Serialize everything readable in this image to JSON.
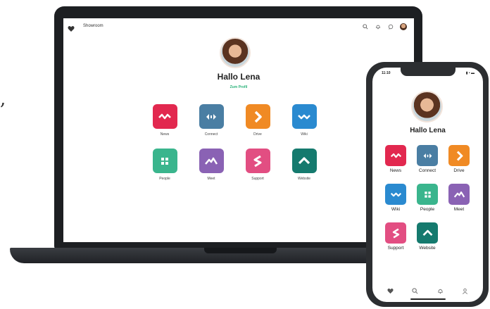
{
  "page": {
    "quote_mark": ","
  },
  "colors": {
    "news": "#e2284f",
    "connect": "#4a7ea3",
    "drive": "#f08a24",
    "wiki": "#2a8ad0",
    "people": "#3ab58d",
    "meet": "#8a62b4",
    "support": "#e24e82",
    "website": "#157a6e",
    "link": "#2bb37a"
  },
  "laptop": {
    "app_title": "Showroom",
    "toolbar": [
      "search-icon",
      "bell-icon",
      "chat-icon",
      "user-avatar"
    ],
    "greeting": "Hallo Lena",
    "profile_link": "Zum Profil",
    "apps": [
      {
        "label": "News",
        "icon": "pulse-icon",
        "color": "news"
      },
      {
        "label": "Connect",
        "icon": "arrows-icon",
        "color": "connect"
      },
      {
        "label": "Drive",
        "icon": "chevron-right-icon",
        "color": "drive"
      },
      {
        "label": "Wiki",
        "icon": "wave-icon",
        "color": "wiki"
      },
      {
        "label": "People",
        "icon": "dots-icon",
        "color": "people"
      },
      {
        "label": "Meet",
        "icon": "mountains-icon",
        "color": "meet"
      },
      {
        "label": "Support",
        "icon": "s-icon",
        "color": "support"
      },
      {
        "label": "Website",
        "icon": "roof-icon",
        "color": "website"
      }
    ]
  },
  "phone": {
    "time": "11:10",
    "status": "▮ • ▬",
    "greeting": "Hallo Lena",
    "apps": [
      {
        "label": "News",
        "icon": "pulse-icon",
        "color": "news"
      },
      {
        "label": "Connect",
        "icon": "arrows-icon",
        "color": "connect"
      },
      {
        "label": "Drive",
        "icon": "chevron-right-icon",
        "color": "drive"
      },
      {
        "label": "Wiki",
        "icon": "wave-icon",
        "color": "wiki"
      },
      {
        "label": "People",
        "icon": "dots-icon",
        "color": "people"
      },
      {
        "label": "Meet",
        "icon": "mountains-icon",
        "color": "meet"
      },
      {
        "label": "Support",
        "icon": "s-icon",
        "color": "support"
      },
      {
        "label": "Website",
        "icon": "roof-icon",
        "color": "website"
      }
    ],
    "tabbar": [
      "heart-icon",
      "search-icon",
      "bell-icon",
      "user-icon"
    ]
  }
}
